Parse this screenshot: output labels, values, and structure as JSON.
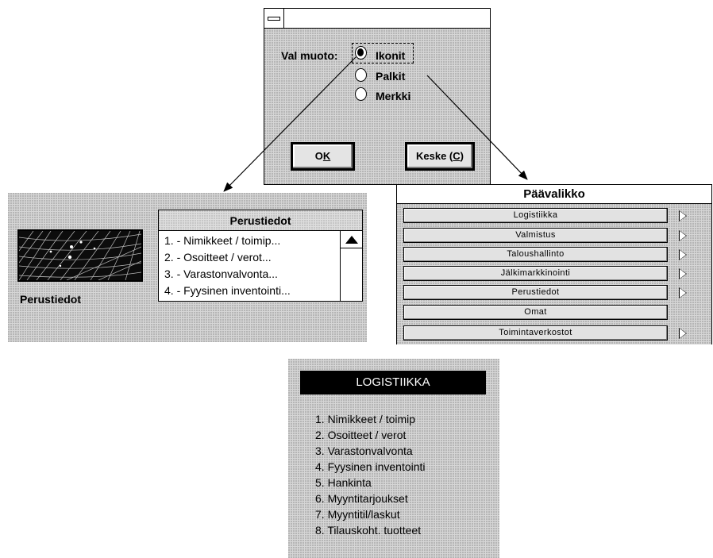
{
  "dialog": {
    "label": "Val muoto:",
    "options": [
      {
        "label": "Ikonit",
        "selected": true
      },
      {
        "label": "Palkit",
        "selected": false
      },
      {
        "label": "Merkki",
        "selected": false
      }
    ],
    "ok_label": "OK",
    "ok_mnemonic": "K",
    "cancel_label_prefix": "Keske (",
    "cancel_mnemonic": "C",
    "cancel_label_suffix": ")"
  },
  "perustiedot": {
    "icon_label": "Perustiedot",
    "list_title": "Perustiedot",
    "items": [
      "1. - Nimikkeet / toimip...",
      "2. - Osoitteet / verot...",
      "3. - Varastonvalvonta...",
      "4. - Fyysinen inventointi..."
    ],
    "scroll_icon": "scroll-up-arrow-icon"
  },
  "paavalikko": {
    "title": "Päävalikko",
    "items": [
      {
        "label": "Logistiikka",
        "submenu": true
      },
      {
        "label": "Valmistus",
        "submenu": true
      },
      {
        "label": "Taloushallinto",
        "submenu": true
      },
      {
        "label": "Jälkimarkkinointi",
        "submenu": true
      },
      {
        "label": "Perustiedot",
        "submenu": true
      },
      {
        "label": "Omat",
        "submenu": false
      },
      {
        "label": "Toimintaverkostot",
        "submenu": true
      }
    ]
  },
  "logistiikka": {
    "title": "LOGISTIIKKA",
    "items": [
      "1. Nimikkeet / toimip",
      "2. Osoitteet / verot",
      "3. Varastonvalvonta",
      "4. Fyysinen inventointi",
      "5. Hankinta",
      "6. Myyntitarjoukset",
      "7. Myyntitil/laskut",
      "8. Tilauskoht. tuotteet"
    ]
  }
}
